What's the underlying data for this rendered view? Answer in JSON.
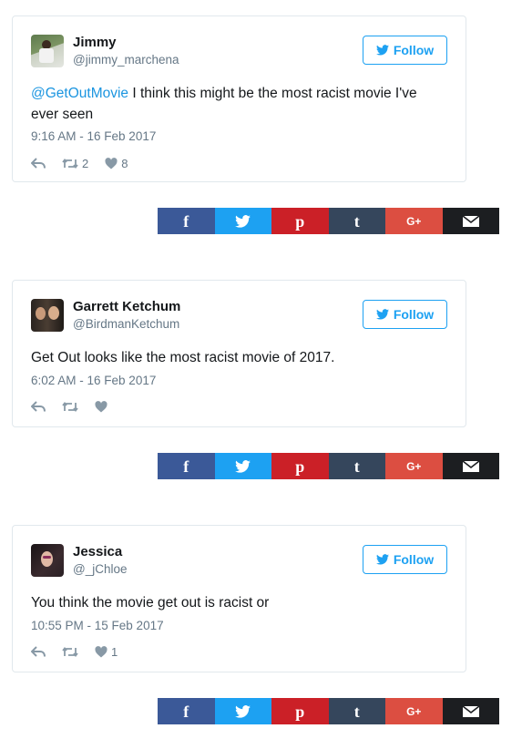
{
  "colors": {
    "link": "#1b95e0",
    "twitter_blue": "#1da1f2",
    "muted": "#657786",
    "facebook": "#3b5998",
    "pinterest": "#cb2027",
    "tumblr": "#35465c",
    "googleplus": "#dc4e41",
    "email": "#1c1e21"
  },
  "share_bar": {
    "facebook_icon": "facebook-icon",
    "twitter_icon": "twitter-bird-icon",
    "pinterest_icon": "pinterest-icon",
    "tumblr_icon": "tumblr-icon",
    "googleplus_icon": "google-plus-icon",
    "email_icon": "envelope-icon",
    "facebook_glyph": "f",
    "pinterest_glyph": "p",
    "tumblr_glyph": "t",
    "googleplus_glyph": "G+"
  },
  "tweets": [
    {
      "name": "Jimmy",
      "handle": "@jimmy_marchena",
      "follow_label": "Follow",
      "mention": "@GetOutMovie",
      "text": " I think this might be the most racist movie I've ever seen",
      "time": "9:16 AM - 16 Feb 2017",
      "retweets": "2",
      "likes": "8"
    },
    {
      "name": "Garrett Ketchum",
      "handle": "@BirdmanKetchum",
      "follow_label": "Follow",
      "mention": "",
      "text": "Get Out looks like the most racist movie of 2017.",
      "time": "6:02 AM - 16 Feb 2017",
      "retweets": "",
      "likes": ""
    },
    {
      "name": "Jessica",
      "handle": "@_jChloe",
      "follow_label": "Follow",
      "mention": "",
      "text": "You think the movie get out is racist or",
      "time": "10:55 PM - 15 Feb 2017",
      "retweets": "",
      "likes": "1"
    }
  ]
}
